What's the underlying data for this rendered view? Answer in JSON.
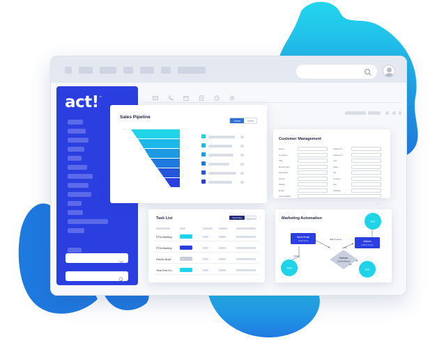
{
  "brand": {
    "logo_text": "act!",
    "logo_mark": "™",
    "primary": "#2b3fe0",
    "accent": "#1fd3e8",
    "blob_blue": "#1f7ae0"
  },
  "topbar": {
    "search_icon": "search-icon",
    "avatar_icon": "user-avatar-icon"
  },
  "toolbar": {
    "icons": [
      "mail-icon",
      "phone-icon",
      "calendar-icon",
      "document-icon",
      "clock-icon",
      "settings-icon"
    ]
  },
  "sales_pipeline": {
    "title": "Sales Pipeline",
    "toggle": [
      "Count",
      "Dollar"
    ],
    "colors": [
      "#1fd3e8",
      "#1bb8e8",
      "#1e9ae2",
      "#1f7ae0",
      "#2357d9",
      "#2b3fe0"
    ]
  },
  "customer_management": {
    "title": "Customer Management",
    "left_fields": [
      "Name",
      "Company",
      "Title",
      "Department",
      "Salutation",
      "Phone",
      "Mobile",
      "Email",
      "Lead Quality"
    ],
    "right_fields": [
      "Address 1",
      "Address 2",
      "City",
      "State",
      "Zip",
      "Country",
      "Fax",
      "Website"
    ]
  },
  "task_list": {
    "title": "Task List",
    "tabs": [
      "Upcoming",
      "Past Due"
    ],
    "more": "⋮",
    "rows": [
      {
        "name": "PTA Meeting",
        "badge_color": "#1fd3e8"
      },
      {
        "name": "PTA Meeting",
        "badge_color": "#2b3fe0"
      },
      {
        "name": "Doctor Appt.",
        "badge_color": "#c9cfdc"
      },
      {
        "name": "Year End Ev...",
        "badge_color": "#1fd3e8"
      }
    ]
  },
  "marketing_automation": {
    "title": "Marketing Automation",
    "send_email": "Send Email",
    "send_email_sub": "(Initial Send)",
    "wait": "Wait 4 Hours",
    "actions": "Actions",
    "actions_sub": "(Add to Group)",
    "decision": "Decision",
    "decision_sub": "(Clicked Button)",
    "start": "Start",
    "yes": "Yes",
    "no": "No",
    "end1": "End",
    "end2": "End",
    "instant": "Instant"
  }
}
